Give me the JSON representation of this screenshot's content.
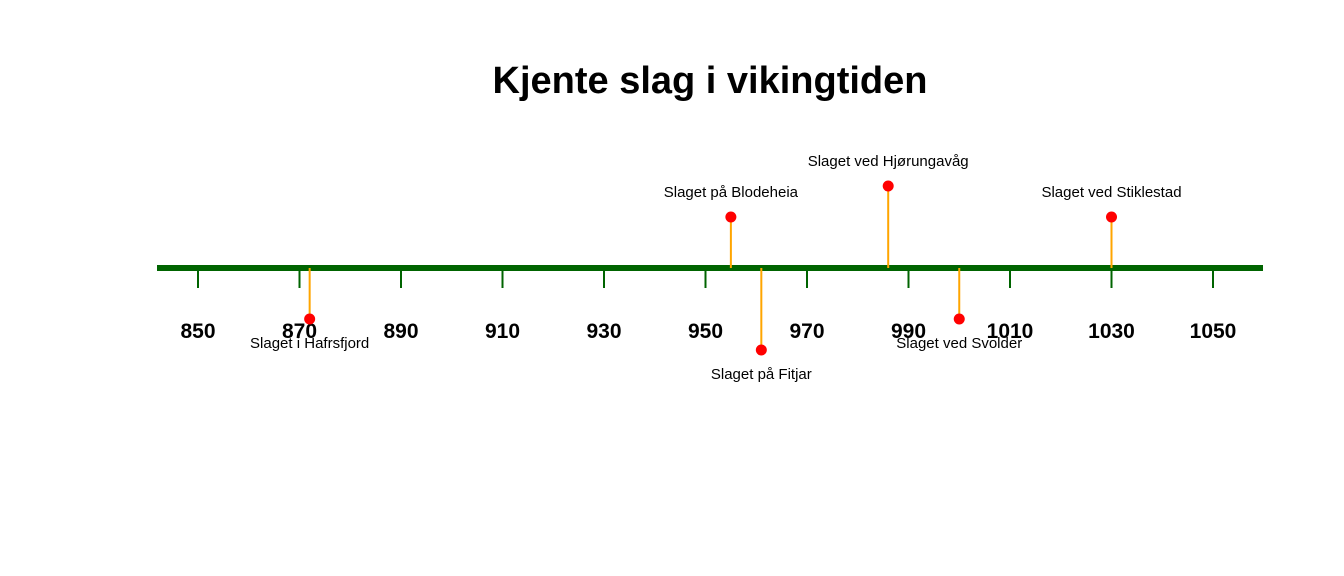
{
  "chart_data": {
    "type": "timeline",
    "title": "Kjente slag i vikingtiden",
    "xlim": [
      842,
      1060
    ],
    "ticks": [
      850,
      870,
      890,
      910,
      930,
      950,
      970,
      990,
      1010,
      1030,
      1050
    ],
    "events": [
      {
        "year": 872,
        "label": "Slaget i Hafrsfjord",
        "side": "below",
        "level": 1
      },
      {
        "year": 955,
        "label": "Slaget på Blodeheia",
        "side": "above",
        "level": 1
      },
      {
        "year": 961,
        "label": "Slaget på Fitjar",
        "side": "below",
        "level": 2
      },
      {
        "year": 986,
        "label": "Slaget ved Hjørungavåg",
        "side": "above",
        "level": 2
      },
      {
        "year": 1000,
        "label": "Slaget ved Svolder",
        "side": "below",
        "level": 1
      },
      {
        "year": 1030,
        "label": "Slaget ved Stiklestad",
        "side": "above",
        "level": 1
      }
    ],
    "colors": {
      "axis": "#006400",
      "stem": "#FFA500",
      "point": "#FF0000"
    }
  }
}
